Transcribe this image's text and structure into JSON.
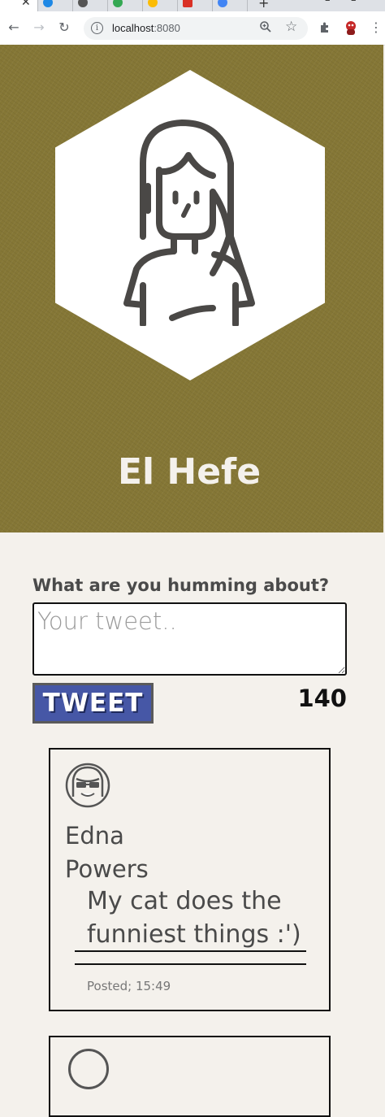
{
  "browser": {
    "url_host": "localhost",
    "url_port": ":8080",
    "new_tab_label": "+"
  },
  "profile": {
    "name": "El Hefe"
  },
  "compose": {
    "label": "What are you humming about?",
    "placeholder": "Your tweet..",
    "button_label": "TWEET",
    "char_count": "140"
  },
  "tweets": [
    {
      "author": "Edna Powers",
      "text": "My cat does the funniest things :')",
      "posted": "Posted; 15:49"
    }
  ],
  "icons": {
    "back": "back-arrow-icon",
    "forward": "forward-arrow-icon",
    "reload": "reload-icon",
    "info": "info-icon",
    "zoom": "zoom-icon",
    "star": "bookmark-star-icon",
    "extensions": "puzzle-icon",
    "profile": "profile-icon",
    "menu": "kebab-menu-icon"
  },
  "colors": {
    "hero_bg": "#857736",
    "page_bg": "#f4f1ec",
    "button_bg": "#4657a6"
  }
}
